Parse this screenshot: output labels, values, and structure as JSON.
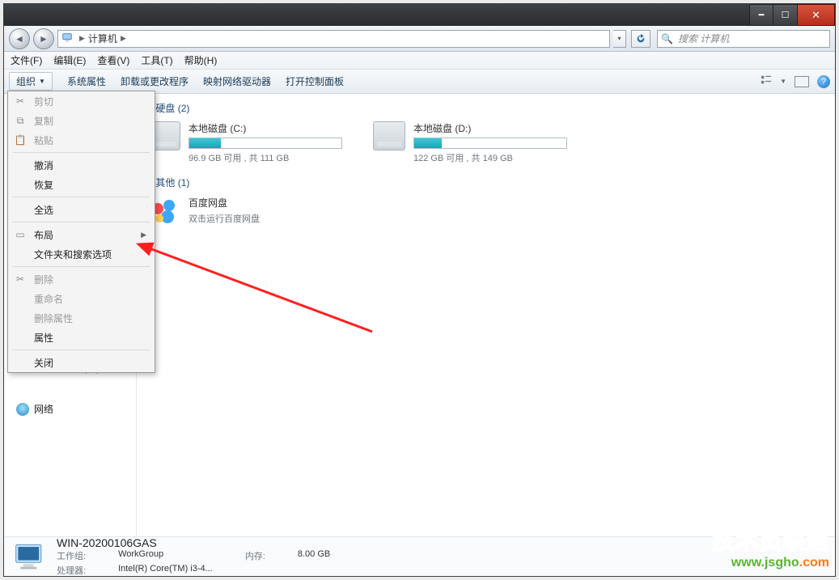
{
  "window": {
    "address_icon": "computer-icon",
    "address_segments": [
      "计算机"
    ],
    "address_drop": "▾",
    "search_placeholder": "搜索 计算机"
  },
  "menubar": [
    "文件(F)",
    "编辑(E)",
    "查看(V)",
    "工具(T)",
    "帮助(H)"
  ],
  "toolbar": {
    "organize": "组织",
    "items": [
      "系统属性",
      "卸载或更改程序",
      "映射网络驱动器",
      "打开控制面板"
    ]
  },
  "sidebar": {
    "disk_d_partial": "本地磁盘 (D:)",
    "network": "网络"
  },
  "content": {
    "hd_title": "硬盘 (2)",
    "other_title": "其他 (1)",
    "drives": [
      {
        "name": "本地磁盘 (C:)",
        "used_pct": 21,
        "sub": "96.9 GB 可用 , 共 111 GB"
      },
      {
        "name": "本地磁盘 (D:)",
        "used_pct": 18,
        "sub": "122 GB 可用 , 共 149 GB"
      }
    ],
    "other": {
      "name": "百度网盘",
      "sub": "双击运行百度网盘"
    }
  },
  "details": {
    "hostname": "WIN-20200106GAS",
    "workgroup_k": "工作组:",
    "workgroup_v": "WorkGroup",
    "cpu_k": "处理器:",
    "cpu_v": "Intel(R) Core(TM) i3-4...",
    "mem_k": "内存:",
    "mem_v": "8.00 GB"
  },
  "dropdown": {
    "items": [
      {
        "label": "剪切",
        "disabled": true,
        "icon": "cut"
      },
      {
        "label": "复制",
        "disabled": true,
        "icon": "copy"
      },
      {
        "label": "粘贴",
        "disabled": true,
        "icon": "paste"
      },
      {
        "sep": true
      },
      {
        "label": "撤消"
      },
      {
        "label": "恢复"
      },
      {
        "sep": true
      },
      {
        "label": "全选"
      },
      {
        "sep": true
      },
      {
        "label": "布局",
        "submenu": true,
        "icon": "layout"
      },
      {
        "label": "文件夹和搜索选项",
        "highlight": true
      },
      {
        "sep": true
      },
      {
        "label": "删除",
        "disabled": true,
        "icon": "delete"
      },
      {
        "label": "重命名",
        "disabled": true
      },
      {
        "label": "删除属性",
        "disabled": true
      },
      {
        "label": "属性"
      },
      {
        "sep": true
      },
      {
        "label": "关闭"
      }
    ]
  },
  "watermark": {
    "title": "技术员联盟",
    "url_1": "www.jsgho",
    "url_2": ".com"
  }
}
